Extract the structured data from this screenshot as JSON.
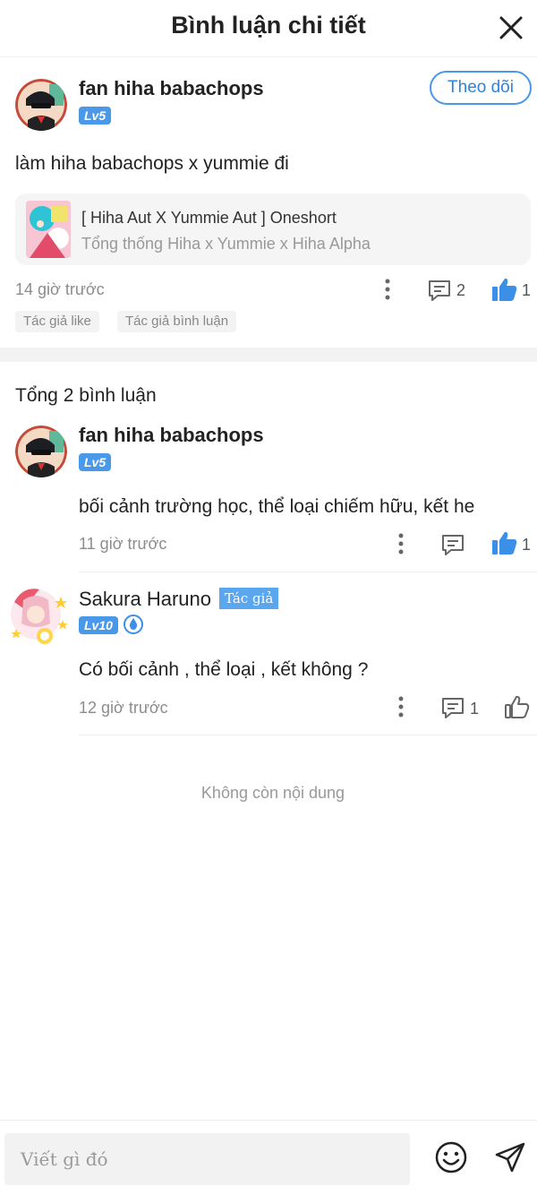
{
  "header": {
    "title": "Bình luận chi tiết"
  },
  "post": {
    "author": "fan hiha babachops",
    "level": "Lv5",
    "follow_label": "Theo dõi",
    "content": "làm hiha babachops x yummie đi",
    "story": {
      "title": "[ Hiha Aut X Yummie Aut ] Oneshort",
      "subtitle": "Tổng thống Hiha x Yummie x Hiha Alpha"
    },
    "time": "14 giờ trước",
    "reply_count": "2",
    "like_count": "1",
    "tags": [
      "Tác giả like",
      "Tác giả bình luận"
    ]
  },
  "replies_header": "Tổng 2 bình luận",
  "replies": [
    {
      "author": "fan hiha babachops",
      "level": "Lv5",
      "content": "bối cảnh trường học, thể loại chiếm hữu, kết he",
      "time": "11 giờ trước",
      "like_count": "1"
    },
    {
      "author": "Sakura Haruno",
      "author_badge": "Tác giả",
      "level": "Lv10",
      "content": "Có bối cảnh , thể loại , kết không ?",
      "time": "12 giờ trước",
      "reply_count": "1"
    }
  ],
  "end_text": "Không còn nội dung",
  "composer": {
    "placeholder": "Viết gì đó"
  },
  "colors": {
    "accent": "#4a98e8",
    "like_active": "#3b8fe6",
    "text": "#222222",
    "muted": "#8c8c8c"
  }
}
